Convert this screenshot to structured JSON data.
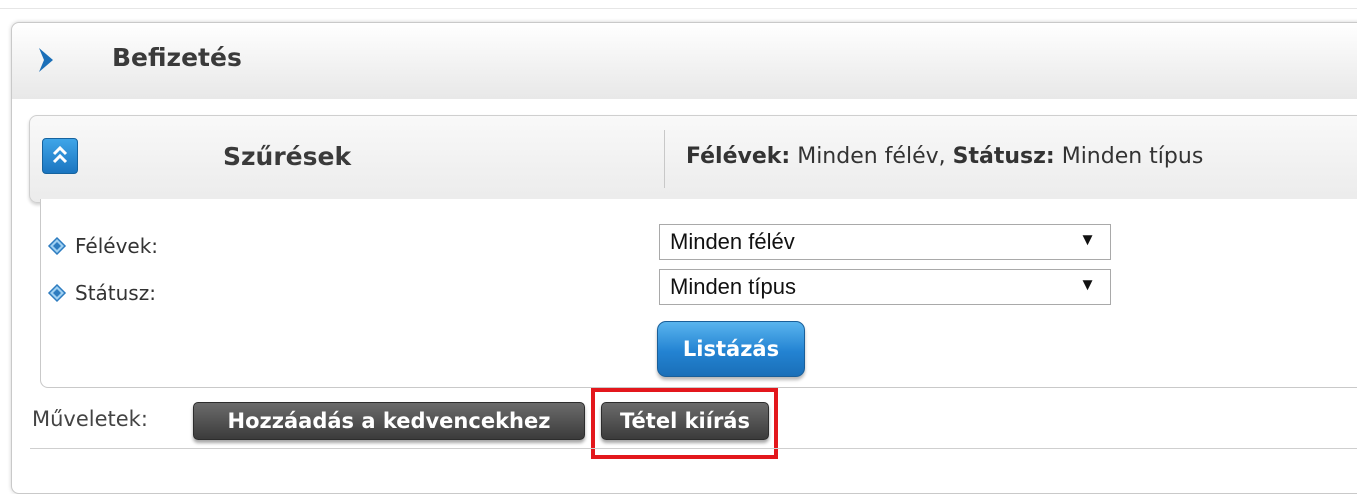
{
  "panel": {
    "title": "Befizetés"
  },
  "filters": {
    "title": "Szűrések",
    "summary": {
      "semester_key": "Félévek:",
      "semester_value": " Minden félév, ",
      "status_key": "Státusz:",
      "status_value": " Minden típus"
    },
    "fields": [
      {
        "label": "Félévek:",
        "value": "Minden félév"
      },
      {
        "label": "Státusz:",
        "value": "Minden típus"
      }
    ],
    "list_button": "Listázás"
  },
  "operations": {
    "label": "Műveletek:",
    "buttons": [
      "Hozzáadás a kedvencekhez",
      "Tétel kiírás"
    ]
  },
  "icons": {
    "header": "chevron-right-icon",
    "toggle": "collapse-up-icon",
    "field_bullet": "diamond-bullet-icon",
    "select_arrow": "triangle-down-icon"
  },
  "colors": {
    "accent_blue": "#1b75c0",
    "highlight_red": "#e3171c"
  }
}
